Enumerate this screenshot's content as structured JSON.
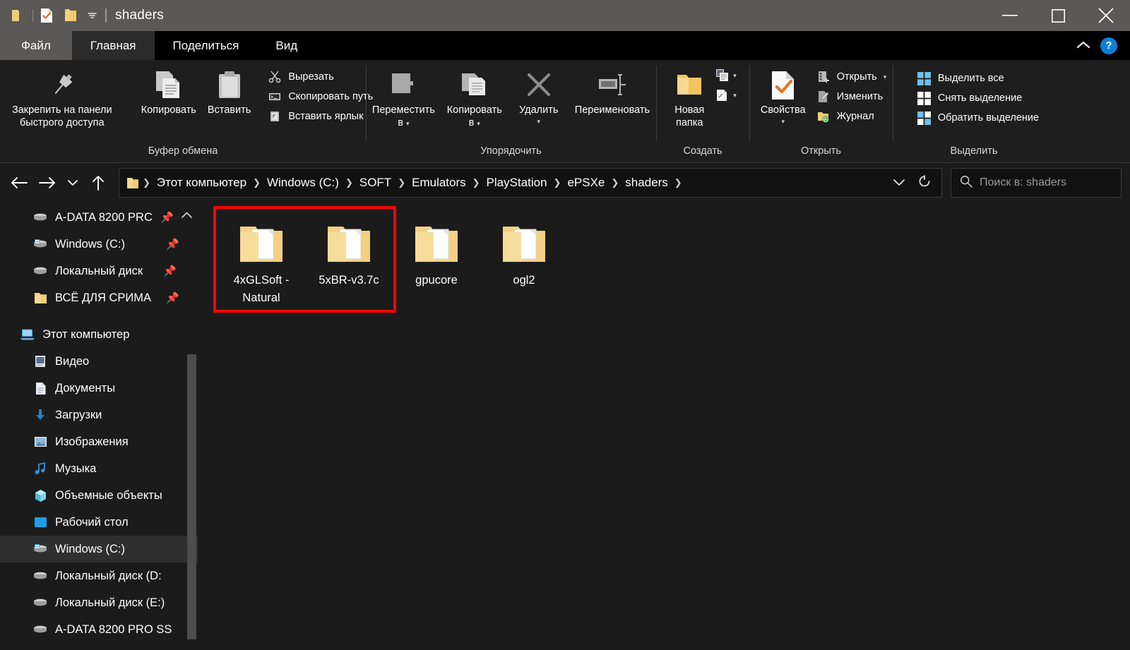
{
  "window": {
    "title": "shaders",
    "quick_access": [
      {
        "name": "folder-icon",
        "label": "Проводник"
      },
      {
        "name": "properties-icon",
        "label": "Свойства"
      },
      {
        "name": "new-folder-icon",
        "label": "Новая папка"
      },
      {
        "name": "chevron-down-icon",
        "label": "Настроить панель быстрого доступа"
      }
    ],
    "controls": {
      "minimize": "Свернуть",
      "maximize": "Развернуть",
      "close": "Закрыть"
    }
  },
  "colors": {
    "titlebar": "#5a5957",
    "ribbon": "#1e1e1e",
    "content": "#1b1b1b",
    "accent_highlight": "#fb0404",
    "help_blue": "#0b7fd4",
    "folder_yellow": "#f5d17a"
  },
  "tabs": [
    {
      "label": "Файл",
      "active": false,
      "style": "file"
    },
    {
      "label": "Главная",
      "active": true,
      "style": "normal"
    },
    {
      "label": "Поделиться",
      "active": false,
      "style": "normal"
    },
    {
      "label": "Вид",
      "active": false,
      "style": "normal"
    }
  ],
  "ribbon_right": {
    "collapse_icon": "chevron-up-icon",
    "help_label": "?"
  },
  "ribbon": {
    "groups": [
      {
        "label": "Буфер обмена",
        "big_buttons": [
          {
            "label": "Закрепить на панели\nбыстрого доступа",
            "icon": "pin-icon"
          },
          {
            "label": "Копировать",
            "icon": "copy-icon"
          },
          {
            "label": "Вставить",
            "icon": "paste-icon"
          }
        ],
        "small_buttons": [
          {
            "label": "Вырезать",
            "icon": "scissors-icon"
          },
          {
            "label": "Скопировать путь",
            "icon": "copy-path-icon"
          },
          {
            "label": "Вставить ярлык",
            "icon": "paste-shortcut-icon"
          }
        ]
      },
      {
        "label": "Упорядочить",
        "big_buttons": [
          {
            "label": "Переместить\nв",
            "icon": "move-to-icon",
            "caret": true
          },
          {
            "label": "Копировать\nв",
            "icon": "copy-to-icon",
            "caret": true
          },
          {
            "label": "Удалить",
            "icon": "delete-icon",
            "caret": true
          },
          {
            "label": "Переименовать",
            "icon": "rename-icon",
            "caret": false
          }
        ],
        "small_buttons": []
      },
      {
        "label": "Создать",
        "big_buttons": [
          {
            "label": "Новая\nпапка",
            "icon": "new-folder-icon"
          }
        ],
        "small_buttons": [
          {
            "label": "",
            "icon": "new-item-icon",
            "caret": true
          },
          {
            "label": "",
            "icon": "easy-access-icon",
            "caret": true
          }
        ]
      },
      {
        "label": "Открыть",
        "big_buttons": [
          {
            "label": "Свойства",
            "icon": "properties-icon",
            "caret": true
          }
        ],
        "small_buttons": [
          {
            "label": "Открыть",
            "icon": "open-icon",
            "caret": true
          },
          {
            "label": "Изменить",
            "icon": "edit-icon"
          },
          {
            "label": "Журнал",
            "icon": "history-icon"
          }
        ]
      },
      {
        "label": "Выделить",
        "big_buttons": [],
        "small_buttons": [
          {
            "label": "Выделить все",
            "icon": "select-all-icon"
          },
          {
            "label": "Снять выделение",
            "icon": "select-none-icon"
          },
          {
            "label": "Обратить выделение",
            "icon": "invert-selection-icon"
          }
        ]
      }
    ]
  },
  "address_bar": {
    "back": "Назад",
    "forward": "Вперед",
    "recent": "Последние расположения",
    "up": "Вверх",
    "breadcrumbs": [
      "Этот компьютер",
      "Windows (C:)",
      "SOFT",
      "Emulators",
      "PlayStation",
      "ePSXe",
      "shaders"
    ],
    "dropdown_icon": "chevron-down-icon",
    "refresh_icon": "refresh-icon",
    "search_placeholder": "Поиск в: shaders"
  },
  "sidebar": {
    "quick_access": [
      {
        "label": "A-DATA 8200 PRC",
        "icon": "drive-icon",
        "pinned": true
      },
      {
        "label": "Windows (C:)",
        "icon": "windows-drive-icon",
        "pinned": true
      },
      {
        "label": "Локальный диск",
        "icon": "drive-icon",
        "pinned": true
      },
      {
        "label": "ВСЁ ДЛЯ СРИМА",
        "icon": "folder-icon",
        "pinned": true
      }
    ],
    "this_pc": {
      "label": "Этот компьютер",
      "icon": "computer-icon"
    },
    "items": [
      {
        "label": "Видео",
        "icon": "video-icon",
        "selected": false
      },
      {
        "label": "Документы",
        "icon": "documents-icon",
        "selected": false
      },
      {
        "label": "Загрузки",
        "icon": "downloads-icon",
        "selected": false
      },
      {
        "label": "Изображения",
        "icon": "pictures-icon",
        "selected": false
      },
      {
        "label": "Музыка",
        "icon": "music-icon",
        "selected": false
      },
      {
        "label": "Объемные объекты",
        "icon": "3d-objects-icon",
        "selected": false
      },
      {
        "label": "Рабочий стол",
        "icon": "desktop-icon",
        "selected": false
      },
      {
        "label": "Windows (C:)",
        "icon": "windows-drive-icon",
        "selected": true
      },
      {
        "label": "Локальный диск (D:",
        "icon": "drive-icon",
        "selected": false
      },
      {
        "label": "Локальный диск (E:)",
        "icon": "drive-icon",
        "selected": false
      },
      {
        "label": "A-DATA 8200 PRO SS",
        "icon": "drive-icon",
        "selected": false
      }
    ]
  },
  "files": [
    {
      "name": "4xGLSoft - Natural",
      "type": "folder",
      "highlighted": true
    },
    {
      "name": "5xBR-v3.7c",
      "type": "folder",
      "highlighted": true
    },
    {
      "name": "gpucore",
      "type": "folder",
      "highlighted": false
    },
    {
      "name": "ogl2",
      "type": "folder",
      "highlighted": false
    }
  ]
}
